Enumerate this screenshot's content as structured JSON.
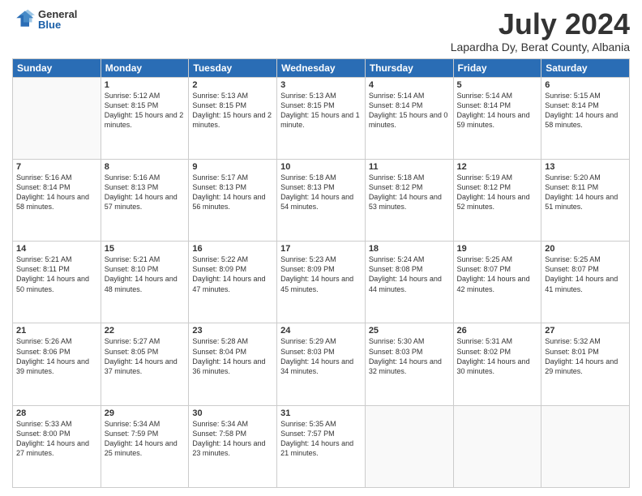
{
  "logo": {
    "general": "General",
    "blue": "Blue"
  },
  "header": {
    "month": "July 2024",
    "location": "Lapardha Dy, Berat County, Albania"
  },
  "days": [
    "Sunday",
    "Monday",
    "Tuesday",
    "Wednesday",
    "Thursday",
    "Friday",
    "Saturday"
  ],
  "weeks": [
    [
      {
        "num": "",
        "sunrise": "",
        "sunset": "",
        "daylight": ""
      },
      {
        "num": "1",
        "sunrise": "Sunrise: 5:12 AM",
        "sunset": "Sunset: 8:15 PM",
        "daylight": "Daylight: 15 hours and 2 minutes."
      },
      {
        "num": "2",
        "sunrise": "Sunrise: 5:13 AM",
        "sunset": "Sunset: 8:15 PM",
        "daylight": "Daylight: 15 hours and 2 minutes."
      },
      {
        "num": "3",
        "sunrise": "Sunrise: 5:13 AM",
        "sunset": "Sunset: 8:15 PM",
        "daylight": "Daylight: 15 hours and 1 minute."
      },
      {
        "num": "4",
        "sunrise": "Sunrise: 5:14 AM",
        "sunset": "Sunset: 8:14 PM",
        "daylight": "Daylight: 15 hours and 0 minutes."
      },
      {
        "num": "5",
        "sunrise": "Sunrise: 5:14 AM",
        "sunset": "Sunset: 8:14 PM",
        "daylight": "Daylight: 14 hours and 59 minutes."
      },
      {
        "num": "6",
        "sunrise": "Sunrise: 5:15 AM",
        "sunset": "Sunset: 8:14 PM",
        "daylight": "Daylight: 14 hours and 58 minutes."
      }
    ],
    [
      {
        "num": "7",
        "sunrise": "Sunrise: 5:16 AM",
        "sunset": "Sunset: 8:14 PM",
        "daylight": "Daylight: 14 hours and 58 minutes."
      },
      {
        "num": "8",
        "sunrise": "Sunrise: 5:16 AM",
        "sunset": "Sunset: 8:13 PM",
        "daylight": "Daylight: 14 hours and 57 minutes."
      },
      {
        "num": "9",
        "sunrise": "Sunrise: 5:17 AM",
        "sunset": "Sunset: 8:13 PM",
        "daylight": "Daylight: 14 hours and 56 minutes."
      },
      {
        "num": "10",
        "sunrise": "Sunrise: 5:18 AM",
        "sunset": "Sunset: 8:13 PM",
        "daylight": "Daylight: 14 hours and 54 minutes."
      },
      {
        "num": "11",
        "sunrise": "Sunrise: 5:18 AM",
        "sunset": "Sunset: 8:12 PM",
        "daylight": "Daylight: 14 hours and 53 minutes."
      },
      {
        "num": "12",
        "sunrise": "Sunrise: 5:19 AM",
        "sunset": "Sunset: 8:12 PM",
        "daylight": "Daylight: 14 hours and 52 minutes."
      },
      {
        "num": "13",
        "sunrise": "Sunrise: 5:20 AM",
        "sunset": "Sunset: 8:11 PM",
        "daylight": "Daylight: 14 hours and 51 minutes."
      }
    ],
    [
      {
        "num": "14",
        "sunrise": "Sunrise: 5:21 AM",
        "sunset": "Sunset: 8:11 PM",
        "daylight": "Daylight: 14 hours and 50 minutes."
      },
      {
        "num": "15",
        "sunrise": "Sunrise: 5:21 AM",
        "sunset": "Sunset: 8:10 PM",
        "daylight": "Daylight: 14 hours and 48 minutes."
      },
      {
        "num": "16",
        "sunrise": "Sunrise: 5:22 AM",
        "sunset": "Sunset: 8:09 PM",
        "daylight": "Daylight: 14 hours and 47 minutes."
      },
      {
        "num": "17",
        "sunrise": "Sunrise: 5:23 AM",
        "sunset": "Sunset: 8:09 PM",
        "daylight": "Daylight: 14 hours and 45 minutes."
      },
      {
        "num": "18",
        "sunrise": "Sunrise: 5:24 AM",
        "sunset": "Sunset: 8:08 PM",
        "daylight": "Daylight: 14 hours and 44 minutes."
      },
      {
        "num": "19",
        "sunrise": "Sunrise: 5:25 AM",
        "sunset": "Sunset: 8:07 PM",
        "daylight": "Daylight: 14 hours and 42 minutes."
      },
      {
        "num": "20",
        "sunrise": "Sunrise: 5:25 AM",
        "sunset": "Sunset: 8:07 PM",
        "daylight": "Daylight: 14 hours and 41 minutes."
      }
    ],
    [
      {
        "num": "21",
        "sunrise": "Sunrise: 5:26 AM",
        "sunset": "Sunset: 8:06 PM",
        "daylight": "Daylight: 14 hours and 39 minutes."
      },
      {
        "num": "22",
        "sunrise": "Sunrise: 5:27 AM",
        "sunset": "Sunset: 8:05 PM",
        "daylight": "Daylight: 14 hours and 37 minutes."
      },
      {
        "num": "23",
        "sunrise": "Sunrise: 5:28 AM",
        "sunset": "Sunset: 8:04 PM",
        "daylight": "Daylight: 14 hours and 36 minutes."
      },
      {
        "num": "24",
        "sunrise": "Sunrise: 5:29 AM",
        "sunset": "Sunset: 8:03 PM",
        "daylight": "Daylight: 14 hours and 34 minutes."
      },
      {
        "num": "25",
        "sunrise": "Sunrise: 5:30 AM",
        "sunset": "Sunset: 8:03 PM",
        "daylight": "Daylight: 14 hours and 32 minutes."
      },
      {
        "num": "26",
        "sunrise": "Sunrise: 5:31 AM",
        "sunset": "Sunset: 8:02 PM",
        "daylight": "Daylight: 14 hours and 30 minutes."
      },
      {
        "num": "27",
        "sunrise": "Sunrise: 5:32 AM",
        "sunset": "Sunset: 8:01 PM",
        "daylight": "Daylight: 14 hours and 29 minutes."
      }
    ],
    [
      {
        "num": "28",
        "sunrise": "Sunrise: 5:33 AM",
        "sunset": "Sunset: 8:00 PM",
        "daylight": "Daylight: 14 hours and 27 minutes."
      },
      {
        "num": "29",
        "sunrise": "Sunrise: 5:34 AM",
        "sunset": "Sunset: 7:59 PM",
        "daylight": "Daylight: 14 hours and 25 minutes."
      },
      {
        "num": "30",
        "sunrise": "Sunrise: 5:34 AM",
        "sunset": "Sunset: 7:58 PM",
        "daylight": "Daylight: 14 hours and 23 minutes."
      },
      {
        "num": "31",
        "sunrise": "Sunrise: 5:35 AM",
        "sunset": "Sunset: 7:57 PM",
        "daylight": "Daylight: 14 hours and 21 minutes."
      },
      {
        "num": "",
        "sunrise": "",
        "sunset": "",
        "daylight": ""
      },
      {
        "num": "",
        "sunrise": "",
        "sunset": "",
        "daylight": ""
      },
      {
        "num": "",
        "sunrise": "",
        "sunset": "",
        "daylight": ""
      }
    ]
  ]
}
